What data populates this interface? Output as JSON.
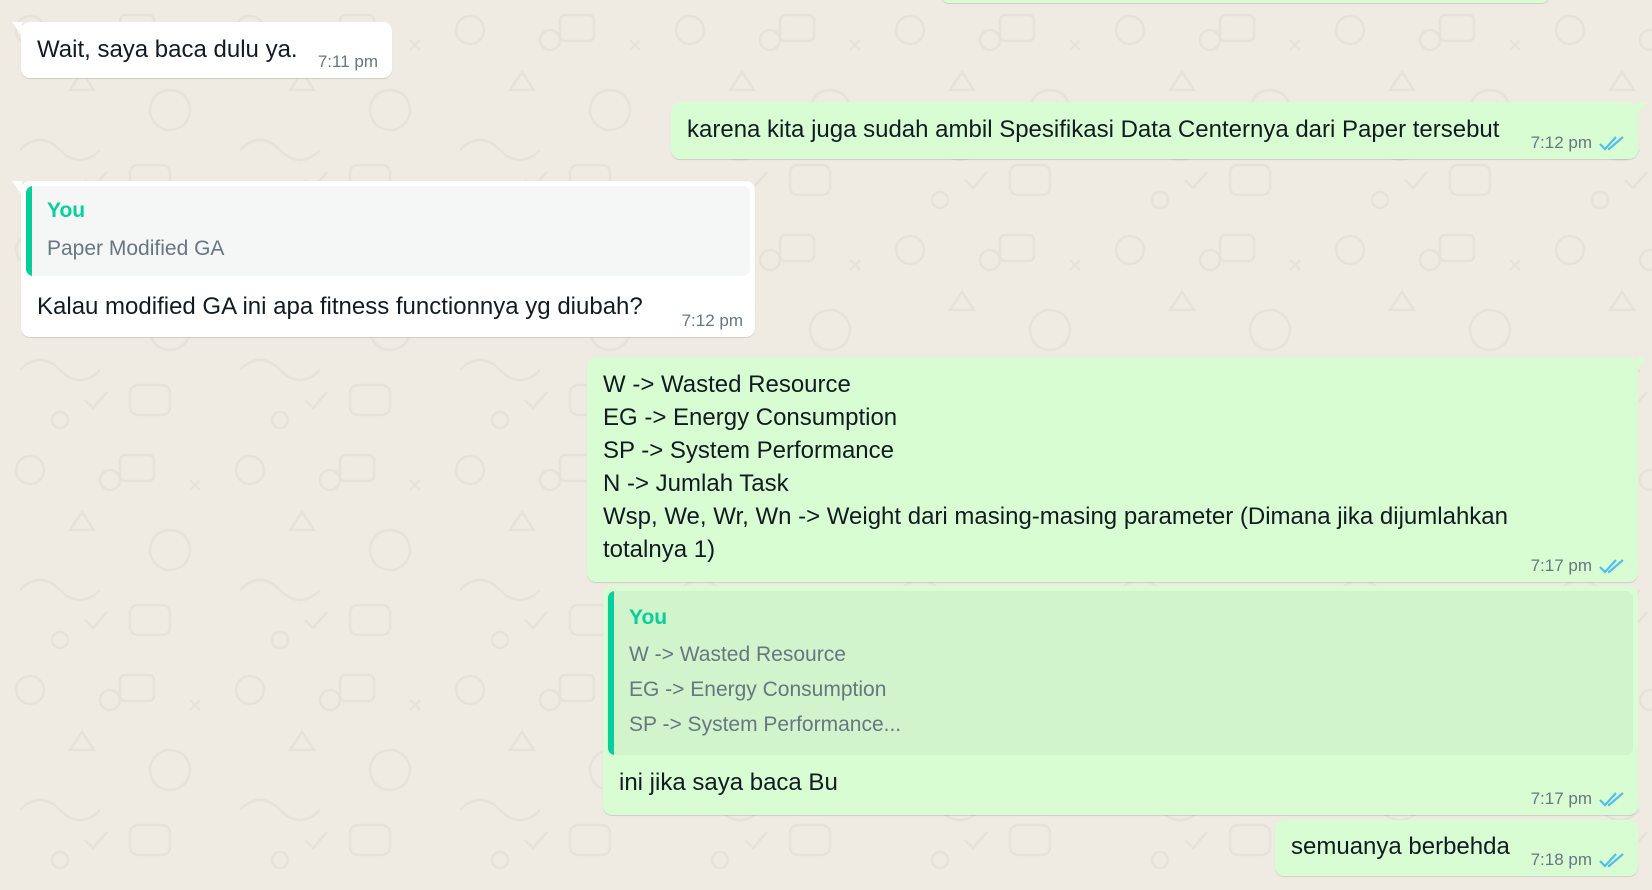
{
  "messages": [
    {
      "id": "m1",
      "direction": "incoming",
      "text": "Wait, saya baca dulu ya.",
      "time": "7:11 pm"
    },
    {
      "id": "m2",
      "direction": "outgoing",
      "text": "karena kita juga sudah ambil Spesifikasi Data Centernya dari Paper tersebut",
      "time": "7:12 pm",
      "status": "read"
    },
    {
      "id": "m3",
      "direction": "incoming",
      "quote": {
        "author": "You",
        "lines": [
          "Paper Modified GA"
        ]
      },
      "text": "Kalau modified GA ini apa fitness functionnya yg diubah?",
      "time": "7:12 pm"
    },
    {
      "id": "m4",
      "direction": "outgoing",
      "lines": [
        "W -> Wasted Resource",
        "EG -> Energy Consumption",
        "SP -> System Performance",
        "N -> Jumlah Task",
        "Wsp, We, Wr, Wn -> Weight dari masing-masing parameter (Dimana jika dijumlahkan",
        "totalnya 1)"
      ],
      "time": "7:17 pm",
      "status": "read"
    },
    {
      "id": "m5",
      "direction": "outgoing",
      "quote": {
        "author": "You",
        "lines": [
          "W -> Wasted Resource",
          "EG -> Energy Consumption",
          "SP -> System Performance..."
        ]
      },
      "text": "ini jika saya baca Bu",
      "time": "7:17 pm",
      "status": "read"
    },
    {
      "id": "m6",
      "direction": "outgoing",
      "text": "semuanya berbehda",
      "time": "7:18 pm",
      "status": "read"
    }
  ],
  "colors": {
    "background": "#efeae2",
    "incoming_bubble": "#ffffff",
    "outgoing_bubble": "#d9fdd3",
    "quote_accent": "#06cf9c",
    "read_ticks": "#53bdeb",
    "meta_text": "#667781"
  },
  "icons": {
    "read_receipt": "double-check-icon"
  }
}
